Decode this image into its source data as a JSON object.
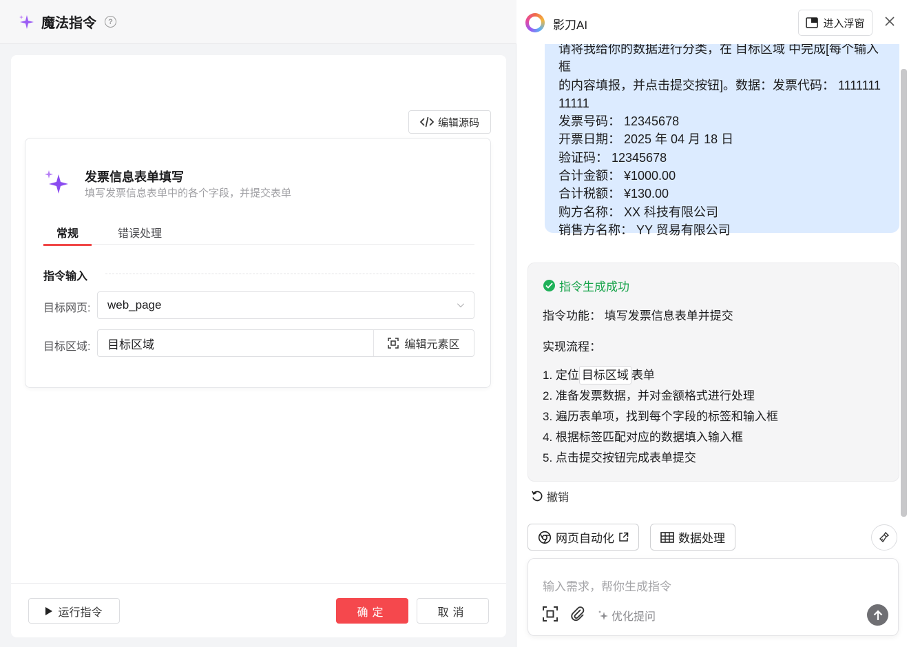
{
  "left": {
    "title": "魔法指令",
    "help_icon": "?",
    "edit_source_label": "编辑源码",
    "form": {
      "title": "发票信息表单填写",
      "subtitle": "填写发票信息表单中的各个字段，并提交表单",
      "tabs": [
        {
          "label": "常规",
          "active": true
        },
        {
          "label": "错误处理",
          "active": false
        }
      ],
      "section_label": "指令输入",
      "target_page_label": "目标网页:",
      "target_page_value": "web_page",
      "target_area_label": "目标区域:",
      "target_area_value": "目标区域",
      "edit_element_label": "编辑元素区"
    },
    "footer": {
      "run_label": "运行指令",
      "ok_label": "确定",
      "cancel_label": "取消"
    }
  },
  "right": {
    "title": "影刀AI",
    "float_label": "进入浮窗",
    "user_message": {
      "lines": [
        "请将我给你的数据进行分类，在 目标区域 中完成[每个输入框",
        "的内容填报，并点击提交按钮]。数据：发票代码： 1111111",
        "11111",
        "发票号码： 12345678",
        "开票日期： 2025 年 04 月 18 日",
        "验证码： 12345678",
        "合计金额： ¥1000.00",
        "合计税额： ¥130.00",
        "购方名称： XX 科技有限公司",
        "销售方名称： YY 贸易有限公司"
      ]
    },
    "ai_reply": {
      "status": "指令生成成功",
      "function": "指令功能： 填写发票信息表单并提交",
      "flow_label": "实现流程：",
      "step1_prefix": "1. 定位",
      "step1_tag": "目标区域",
      "step1_suffix": "表单",
      "steps": [
        "2. 准备发票数据，并对金额格式进行处理",
        "3. 遍历表单项，找到每个字段的标签和输入框",
        "4. 根据标签匹配对应的数据填入输入框",
        "5. 点击提交按钮完成表单提交"
      ]
    },
    "undo_label": "撤销",
    "chips": {
      "web_automation": "网页自动化",
      "data_processing": "数据处理"
    },
    "input": {
      "placeholder": "输入需求，帮你生成指令",
      "optimize_label": "优化提问"
    }
  },
  "colors": {
    "accent_red": "#f5484d",
    "bubble_blue": "#dcebff",
    "success_green": "#17a34a",
    "sparkle_purple": "#8b4cf0"
  }
}
